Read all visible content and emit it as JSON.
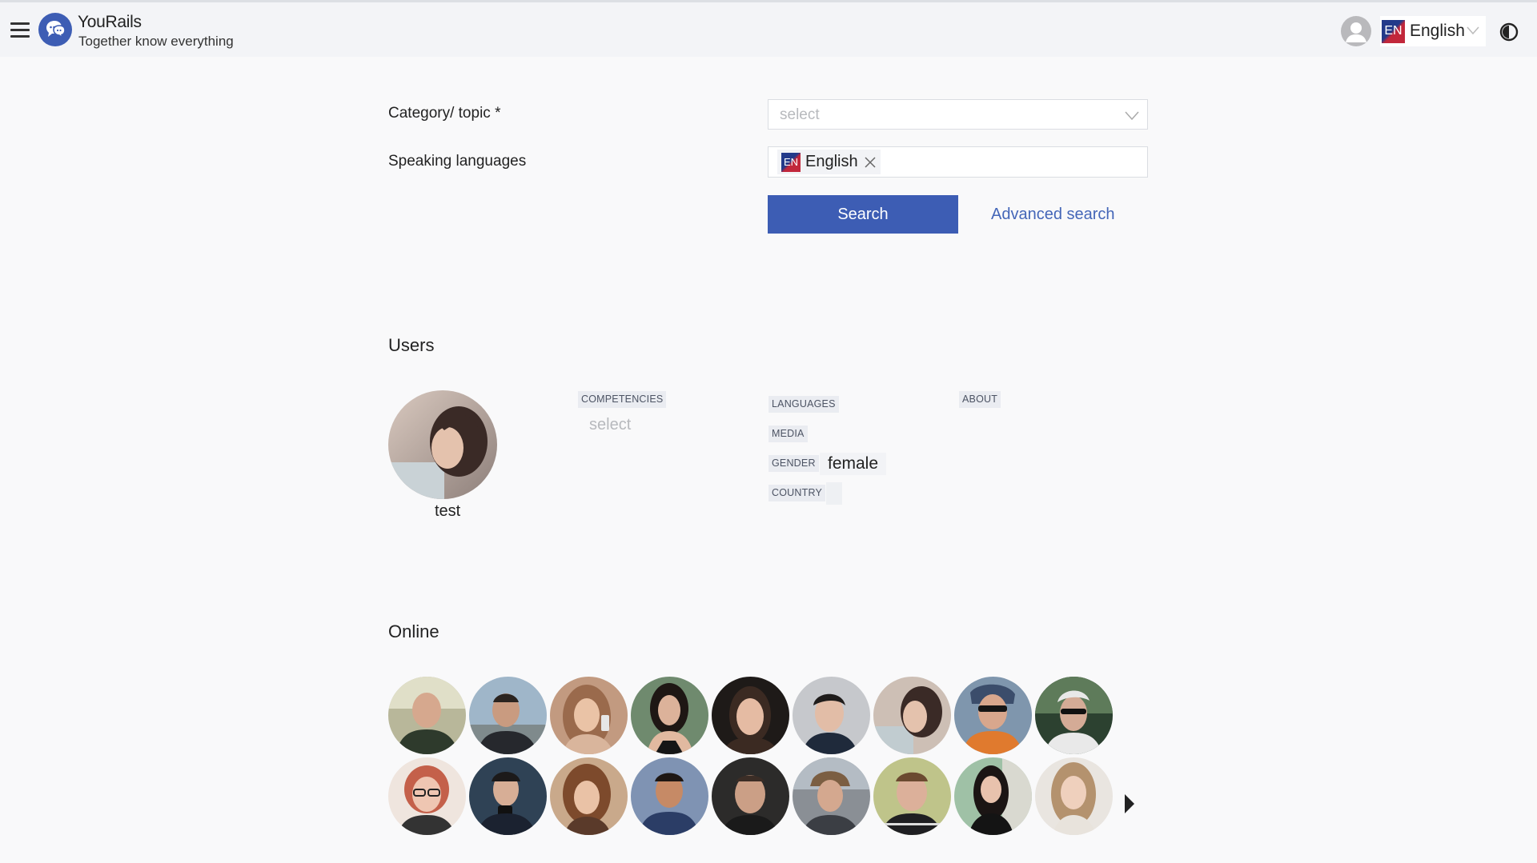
{
  "header": {
    "brand_name": "YouRails",
    "tagline": "Together know everything",
    "language_code": "EN",
    "language_label": "English"
  },
  "search_form": {
    "category_label": "Category/ topic *",
    "category_placeholder": "select",
    "languages_label": "Speaking languages",
    "selected_language": {
      "code": "EN",
      "label": "English"
    },
    "search_button": "Search",
    "advanced_search": "Advanced search"
  },
  "users": {
    "title": "Users",
    "card": {
      "name": "test",
      "competencies_tag": "COMPETENCIES",
      "competencies_value": "select",
      "languages_tag": "LANGUAGES",
      "media_tag": "MEDIA",
      "gender_tag": "GENDER",
      "gender_value": "female",
      "country_tag": "COUNTRY",
      "about_tag": "ABOUT"
    }
  },
  "online": {
    "title": "Online",
    "count_visible": 18
  },
  "colors": {
    "accent": "#3d5db4",
    "link": "#4466b8",
    "tag_bg": "#eaecf1",
    "page_bg": "#f9f9fa",
    "header_bg": "#f3f4f7"
  },
  "icons": {
    "menu": "hamburger-menu-icon",
    "logo": "chat-bubbles-logo-icon",
    "account": "user-avatar-icon",
    "theme": "contrast-toggle-icon",
    "dropdown": "chevron-down-icon",
    "remove": "close-icon",
    "next": "chevron-right-icon"
  }
}
